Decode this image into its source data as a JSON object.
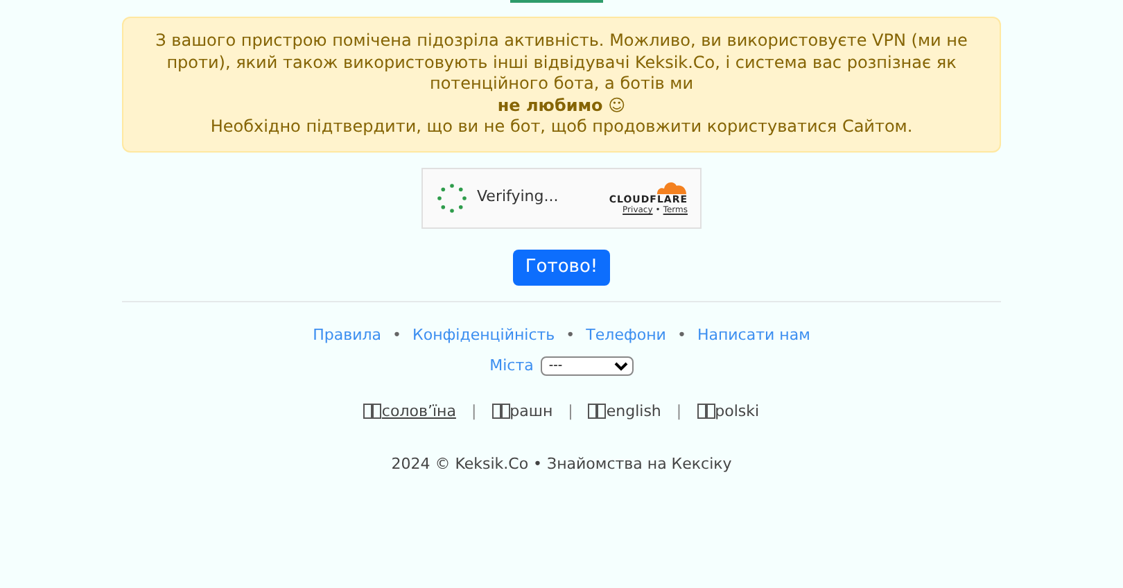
{
  "alert": {
    "lines": [
      "З вашого пристрою помічена підозріла активність. Можливо, ви використовуєте VPN (ми не проти), який також використовують інші відвідувачі Keksik.Co, і система вас розпізнає як потенційного бота, а ботів ми",
      "**не любимо** ☺",
      "Необхідно підтвердити, що ви не бот, щоб продовжити користуватися Сайтом."
    ]
  },
  "captcha": {
    "status": "Verifying...",
    "brand": "CLOUDFLARE",
    "links": [
      "Privacy",
      "Terms"
    ],
    "separator": "•"
  },
  "done_button": "Готово!",
  "footer": {
    "links": [
      "Правила",
      "Конфіденційність",
      "Телефони",
      "Написати нам"
    ],
    "separator": "•",
    "cities": {
      "label": "Міста",
      "value": "---"
    },
    "languages": [
      {
        "label": "соловʼїна",
        "selected": true
      },
      {
        "label": "рашн",
        "selected": false
      },
      {
        "label": "english",
        "selected": false
      },
      {
        "label": "polski",
        "selected": false
      }
    ],
    "language_separator": "|",
    "copyright": "2024 © Keksik.Co • Знайомства на Кексіку"
  }
}
